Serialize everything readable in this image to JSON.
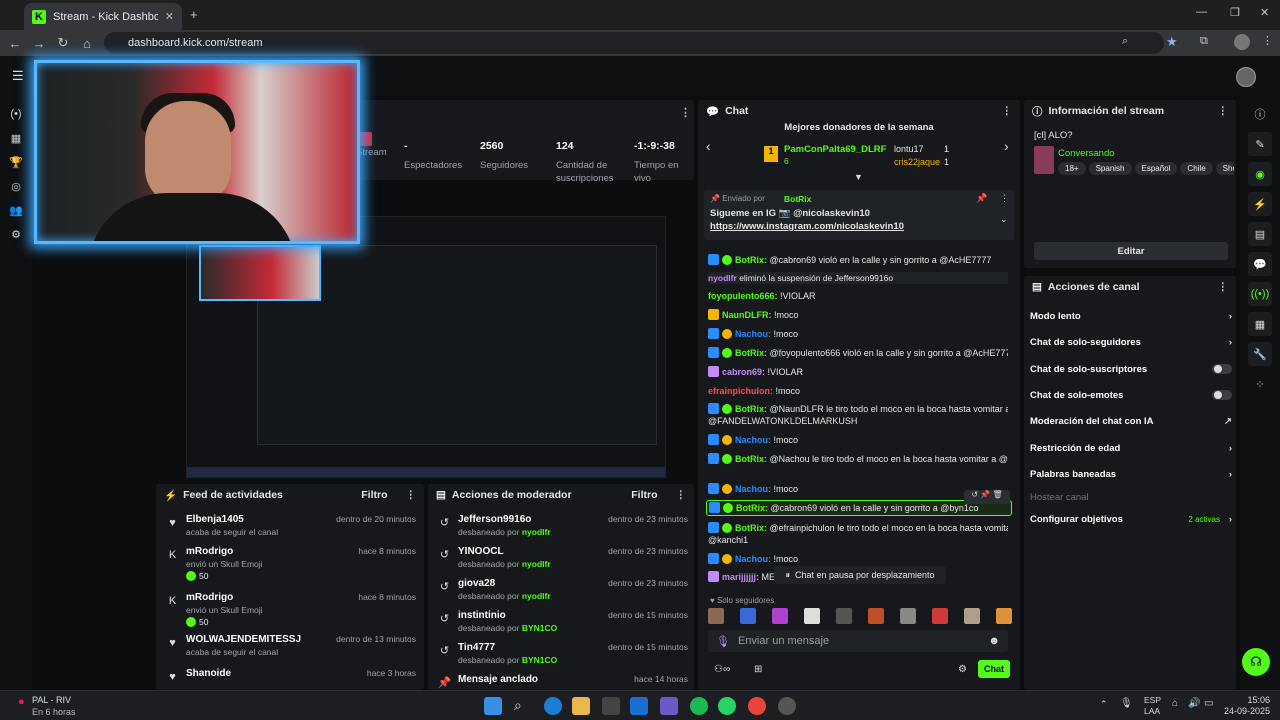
{
  "browser": {
    "tab_title": "Stream - Kick Dashboard",
    "url": "dashboard.kick.com/stream"
  },
  "stats": [
    {
      "value": "",
      "label": "Stream"
    },
    {
      "value": "-",
      "label": "Espectadores"
    },
    {
      "value": "2560",
      "label": "Seguidores"
    },
    {
      "value": "124",
      "label": "Cantidad de suscripciones"
    },
    {
      "value": "-1:-9:-38",
      "label": "Tiempo en vivo"
    }
  ],
  "activity_feed": {
    "title": "Feed de actividades",
    "filter": "Filtro",
    "items": [
      {
        "name": "Elbenja1405",
        "sub": "acaba de seguir el canal",
        "time": "dentro de 20 minutos",
        "extra": ""
      },
      {
        "name": "mRodrigo",
        "sub": "envió un Skull Emoji",
        "time": "hace 8 minutos",
        "extra": "50"
      },
      {
        "name": "mRodrigo",
        "sub": "envió un Skull Emoji",
        "time": "hace 8 minutos",
        "extra": "50"
      },
      {
        "name": "WOLWAJENDEMITESSJ",
        "sub": "acaba de seguir el canal",
        "time": "dentro de 13 minutos",
        "extra": ""
      },
      {
        "name": "Shanoide",
        "sub": "",
        "time": "hace 3 horas",
        "extra": ""
      }
    ]
  },
  "moderator_actions": {
    "title": "Acciones de moderador",
    "filter": "Filtro",
    "items": [
      {
        "name": "Jefferson9916o",
        "sub": "desbaneado por",
        "by": "nyodlfr",
        "time": "dentro de 23 minutos"
      },
      {
        "name": "YINOOCL",
        "sub": "desbaneado por",
        "by": "nyodlfr",
        "time": "dentro de 23 minutos"
      },
      {
        "name": "giova28",
        "sub": "desbaneado por",
        "by": "nyodlfr",
        "time": "dentro de 23 minutos"
      },
      {
        "name": "instintinio",
        "sub": "desbaneado por",
        "by": "BYN1CO",
        "time": "dentro de 15 minutos"
      },
      {
        "name": "Tin4777",
        "sub": "desbaneado por",
        "by": "BYN1CO",
        "time": "dentro de 15 minutos"
      },
      {
        "name": "Mensaje anclado",
        "sub": "",
        "by": "",
        "time": "hace 14 horas"
      }
    ]
  },
  "chat": {
    "title": "Chat",
    "donors_title": "Mejores donadores de la semana",
    "donor1": "PamConPalta69_DLRF",
    "donor1_count": "6",
    "donor2": "lontu17",
    "donor2_count": "1",
    "donor3": "cris22jaque",
    "donor3_count": "1",
    "pinned_by_label": "Enviado por",
    "pinned_by": "BotRix",
    "pinned_text": "Sigueme en IG 📷 @nicolaskevin10",
    "pinned_link": "https://www.instagram.com/nicolaskevin10",
    "messages": [
      {
        "user": "BotRix:",
        "text": "@cabron69 violó en la calle y sin gorrito a @AcHE7777",
        "color": "#53fc18"
      },
      {
        "user": "nyodlfr",
        "text": "eliminó la suspensión de Jefferson9916o",
        "color": "#c58af9"
      },
      {
        "user": "foyopulento666:",
        "text": "!VIOLAR",
        "color": "#53fc18"
      },
      {
        "user": "NaunDLFR:",
        "text": "!moco",
        "color": "#53fc18"
      },
      {
        "user": "Nachou:",
        "text": "!moco",
        "color": "#2a8cff"
      },
      {
        "user": "BotRix:",
        "text": "@foyopulento666 violó en la calle y sin gorrito a @AcHE7777",
        "color": "#53fc18"
      },
      {
        "user": "cabron69:",
        "text": "!VIOLAR",
        "color": "#c58af9"
      },
      {
        "user": "efrainpichulon:",
        "text": "!moco",
        "color": "#ff4a4a"
      },
      {
        "user": "BotRix:",
        "text": "@NaunDLFR le tiro todo el moco en la boca hasta vomitar a",
        "color": "#53fc18"
      },
      {
        "user": "",
        "text": "@FANDELWATONKLDELMARKUSH",
        "color": "#53fc18"
      },
      {
        "user": "Nachou:",
        "text": "!moco",
        "color": "#2a8cff"
      },
      {
        "user": "BotRix:",
        "text": "@Nachou le tiro todo el moco en la boca hasta vomitar a @Kruick",
        "color": "#53fc18"
      },
      {
        "user": "Nachou:",
        "text": "!moco",
        "color": "#2a8cff"
      },
      {
        "user": "BotRix:",
        "text": "@cabron69 violó en la calle y sin gorrito a @byn1co",
        "color": "#53fc18"
      },
      {
        "user": "BotRix:",
        "text": "@efrainpichulon le tiro todo el moco en la boca hasta vomitar a",
        "color": "#53fc18"
      },
      {
        "user": "",
        "text": "@kanchi1",
        "color": "#53fc18"
      },
      {
        "user": "Nachou:",
        "text": "!moco",
        "color": "#2a8cff"
      },
      {
        "user": "marijjjjjj:",
        "text": "ME",
        "color": "#c58af9"
      }
    ],
    "paused": "Chat en pausa por desplazamiento",
    "followers_only": "Solo seguidores",
    "input_placeholder": "Enviar un mensaje",
    "send": "Chat"
  },
  "stream_info": {
    "title": "Información del stream",
    "stream_title": "[cl] ALO?",
    "category": "Conversando",
    "tags": [
      "18+",
      "Spanish",
      "Español",
      "Chile",
      "Shooter"
    ],
    "edit": "Editar"
  },
  "channel_actions": {
    "title": "Acciones de canal",
    "items": [
      {
        "label": "Modo lento",
        "control": "chevron"
      },
      {
        "label": "Chat de solo-seguidores",
        "control": "chevron"
      },
      {
        "label": "Chat de solo-suscriptores",
        "control": "toggle"
      },
      {
        "label": "Chat de solo-emotes",
        "control": "toggle"
      },
      {
        "label": "Moderación del chat con IA",
        "control": "external"
      },
      {
        "label": "Restricción de edad",
        "control": "chevron"
      },
      {
        "label": "Palabras baneadas",
        "control": "chevron"
      },
      {
        "label": "Hostear canal",
        "control": "none"
      },
      {
        "label": "Configurar objetivos",
        "control": "chevron"
      }
    ],
    "goals_active": "2 activas"
  },
  "taskbar": {
    "weather_title": "PAL - RIV",
    "weather_sub": "En 6 horas",
    "lang": "ESP",
    "lang2": "LAA",
    "time": "15:06",
    "date": "24-09-2025"
  }
}
